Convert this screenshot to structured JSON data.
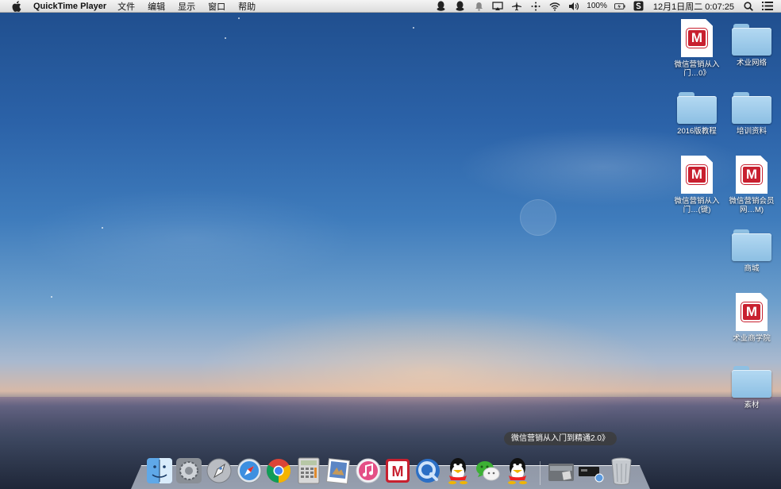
{
  "menubar": {
    "app_name": "QuickTime Player",
    "menus": [
      "文件",
      "编辑",
      "显示",
      "窗口",
      "帮助"
    ],
    "battery": "100%",
    "clock": "12月1日周二  0:07:25",
    "status_icons": [
      "qq-icon",
      "qq-icon",
      "notification-icon",
      "airplay-icon",
      "plane-icon",
      "bluetooth-icon",
      "wifi-icon",
      "volume-icon",
      "battery-icon",
      "sync-icon",
      "search-icon",
      "list-icon"
    ]
  },
  "desktop": {
    "icons": [
      {
        "label": "微信营销从入门…0》",
        "type": "document"
      },
      {
        "label": "术业网络",
        "type": "folder"
      },
      {
        "label": "2016版教程",
        "type": "folder"
      },
      {
        "label": "培训资料",
        "type": "folder"
      },
      {
        "label": "微信营销从入门…(键)",
        "type": "document"
      },
      {
        "label": "微信营销会员网…M)",
        "type": "document"
      },
      {
        "label": "商城",
        "type": "folder"
      },
      {
        "label": "术业商学院",
        "type": "document"
      },
      {
        "label": "素材",
        "type": "folder"
      }
    ]
  },
  "dock": {
    "tooltip": "微信营销从入门到精通2.0》",
    "items": [
      "finder-icon",
      "system-preferences-icon",
      "launchpad-icon",
      "safari-icon",
      "chrome-icon",
      "calculator-icon",
      "preview-icon",
      "itunes-icon",
      "mindmanager-icon",
      "quicktime-icon",
      "qq-icon",
      "wechat-icon",
      "qq-icon",
      "documents-stack-icon",
      "downloads-stack-icon",
      "trash-icon"
    ]
  },
  "colors": {
    "m_badge": "#c8202f",
    "folder": "#8cbfe3",
    "menubar": "#e6e6e6"
  }
}
